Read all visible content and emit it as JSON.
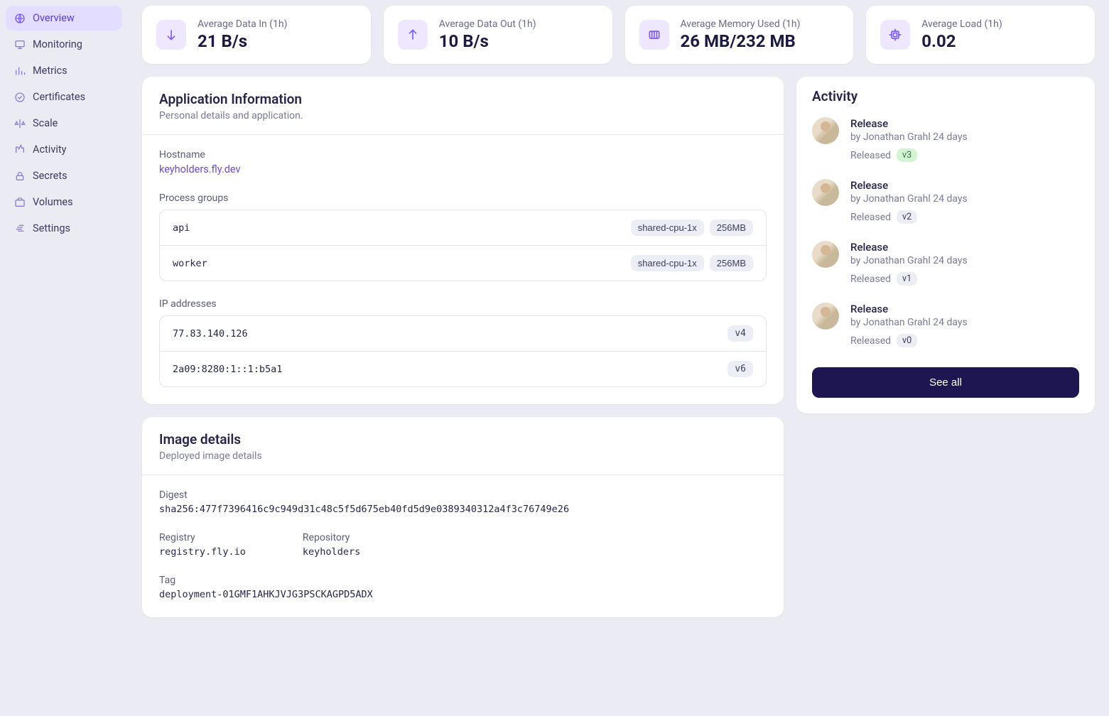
{
  "sidebar": {
    "items": [
      {
        "label": "Overview"
      },
      {
        "label": "Monitoring"
      },
      {
        "label": "Metrics"
      },
      {
        "label": "Certificates"
      },
      {
        "label": "Scale"
      },
      {
        "label": "Activity"
      },
      {
        "label": "Secrets"
      },
      {
        "label": "Volumes"
      },
      {
        "label": "Settings"
      }
    ]
  },
  "stats": [
    {
      "label": "Average Data In (1h)",
      "value": "21 B/s"
    },
    {
      "label": "Average Data Out (1h)",
      "value": "10 B/s"
    },
    {
      "label": "Average Memory Used (1h)",
      "value": "26 MB/232 MB"
    },
    {
      "label": "Average Load (1h)",
      "value": "0.02"
    }
  ],
  "appinfo": {
    "title": "Application Information",
    "subtitle": "Personal details and application.",
    "hostname_label": "Hostname",
    "hostname": "keyholders.fly.dev",
    "pg_label": "Process groups",
    "process_groups": [
      {
        "name": "api",
        "cpu": "shared-cpu-1x",
        "mem": "256MB"
      },
      {
        "name": "worker",
        "cpu": "shared-cpu-1x",
        "mem": "256MB"
      }
    ],
    "ip_label": "IP addresses",
    "ips": [
      {
        "addr": "77.83.140.126",
        "ver": "v4"
      },
      {
        "addr": "2a09:8280:1::1:b5a1",
        "ver": "v6"
      }
    ]
  },
  "image": {
    "title": "Image details",
    "subtitle": "Deployed image details",
    "digest_label": "Digest",
    "digest": "sha256:477f7396416c9c949d31c48c5f5d675eb40fd5d9e0389340312a4f3c76749e26",
    "registry_label": "Registry",
    "registry": "registry.fly.io",
    "repository_label": "Repository",
    "repository": "keyholders",
    "tag_label": "Tag",
    "tag": "deployment-01GMF1AHKJVJG3PSCKAGPD5ADX"
  },
  "activity": {
    "title": "Activity",
    "see_all": "See all",
    "items": [
      {
        "title": "Release",
        "by": "by Jonathan Grahl 24 days",
        "status": "Released",
        "version": "v3",
        "latest": true
      },
      {
        "title": "Release",
        "by": "by Jonathan Grahl 24 days",
        "status": "Released",
        "version": "v2",
        "latest": false
      },
      {
        "title": "Release",
        "by": "by Jonathan Grahl 24 days",
        "status": "Released",
        "version": "v1",
        "latest": false
      },
      {
        "title": "Release",
        "by": "by Jonathan Grahl 24 days",
        "status": "Released",
        "version": "v0",
        "latest": false
      }
    ]
  }
}
